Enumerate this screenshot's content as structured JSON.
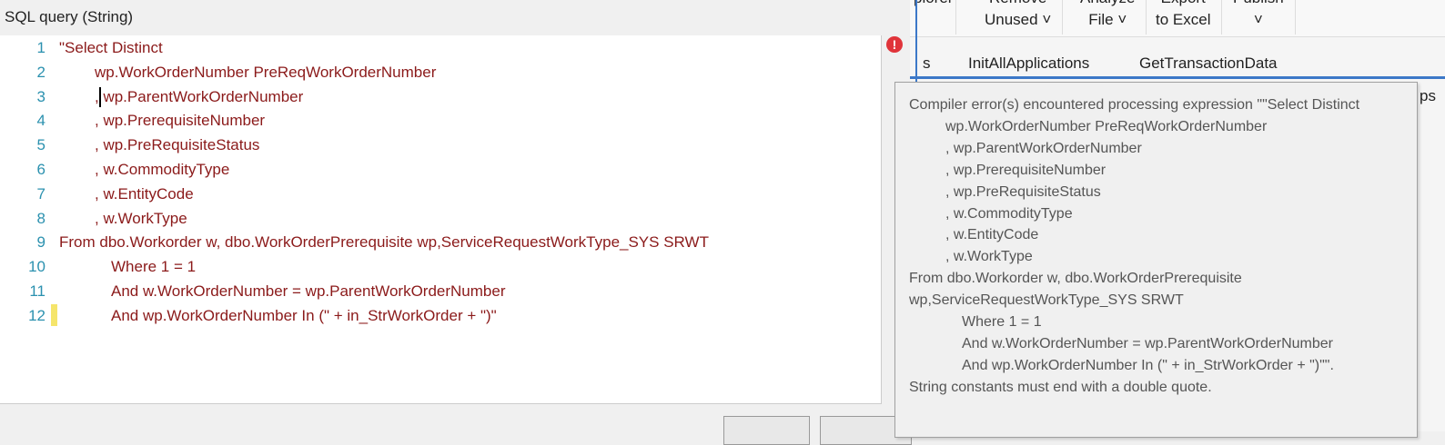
{
  "dialog": {
    "title": "SQL query (String)"
  },
  "ribbon": {
    "buttons": [
      {
        "l1": "",
        "l2": "plorer"
      },
      {
        "l1": "Remove",
        "l2": "Unused ˅"
      },
      {
        "l1": "Analyze",
        "l2": "File ˅"
      },
      {
        "l1": "Export",
        "l2": "to Excel"
      },
      {
        "l1": "Publish",
        "l2": "˅"
      }
    ],
    "tabs": [
      "s",
      "InitAllApplications",
      "GetTransactionData"
    ],
    "peek": "ps"
  },
  "editor": {
    "lines": [
      {
        "n": "1",
        "indent": 0,
        "text": "\"Select Distinct"
      },
      {
        "n": "2",
        "indent": 2,
        "text": "wp.WorkOrderNumber PreReqWorkOrderNumber"
      },
      {
        "n": "3",
        "indent": 2,
        "text": ", wp.ParentWorkOrderNumber"
      },
      {
        "n": "4",
        "indent": 2,
        "text": ", wp.PrerequisiteNumber"
      },
      {
        "n": "5",
        "indent": 2,
        "text": ", wp.PreRequisiteStatus"
      },
      {
        "n": "6",
        "indent": 2,
        "text": ", w.CommodityType"
      },
      {
        "n": "7",
        "indent": 2,
        "text": ", w.EntityCode"
      },
      {
        "n": "8",
        "indent": 2,
        "text": ", w.WorkType"
      },
      {
        "n": "9",
        "indent": 0,
        "text": "From dbo.Workorder w, dbo.WorkOrderPrerequisite wp,ServiceRequestWorkType_SYS SRWT"
      },
      {
        "n": "10",
        "indent": 1,
        "text": "Where 1 = 1"
      },
      {
        "n": "11",
        "indent": 1,
        "text": "And w.WorkOrderNumber = wp.ParentWorkOrderNumber"
      },
      {
        "n": "12",
        "indent": 1,
        "text": "And wp.WorkOrderNumber In (\" + in_StrWorkOrder + \")\""
      }
    ],
    "error_icon": "!"
  },
  "tooltip": {
    "lines": [
      {
        "indent": 0,
        "text": "Compiler error(s) encountered processing expression \"\"Select Distinct"
      },
      {
        "indent": 2,
        "text": "wp.WorkOrderNumber PreReqWorkOrderNumber"
      },
      {
        "indent": 2,
        "text": ", wp.ParentWorkOrderNumber"
      },
      {
        "indent": 2,
        "text": ", wp.PrerequisiteNumber"
      },
      {
        "indent": 2,
        "text": ", wp.PreRequisiteStatus"
      },
      {
        "indent": 2,
        "text": ", w.CommodityType"
      },
      {
        "indent": 2,
        "text": ", w.EntityCode"
      },
      {
        "indent": 2,
        "text": ", w.WorkType"
      },
      {
        "indent": 0,
        "text": "From dbo.Workorder w, dbo.WorkOrderPrerequisite"
      },
      {
        "indent": 0,
        "text": "wp,ServiceRequestWorkType_SYS SRWT"
      },
      {
        "indent": 1,
        "text": "Where 1 = 1"
      },
      {
        "indent": 1,
        "text": "And w.WorkOrderNumber = wp.ParentWorkOrderNumber"
      },
      {
        "indent": 1,
        "text": "And wp.WorkOrderNumber In (\" + in_StrWorkOrder + \")\"\"."
      },
      {
        "indent": 0,
        "text": "String constants must end with a double quote."
      }
    ]
  }
}
